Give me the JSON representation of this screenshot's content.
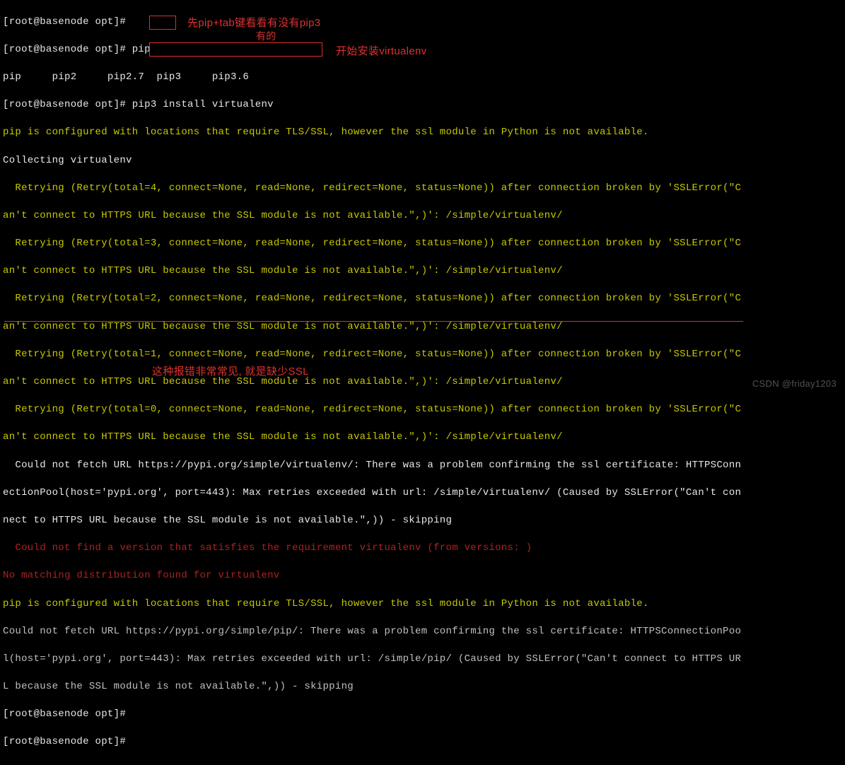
{
  "prompts": {
    "p1": "[root@basenode opt]#",
    "p2": "[root@basenode opt]# ",
    "p3": "[root@basenode opt]# ",
    "p4": "[root@basenode opt]#",
    "p5": "[root@basenode opt]#"
  },
  "cmds": {
    "pip": "pip",
    "install": "pip3 install virtualenv"
  },
  "completions": "pip     pip2     pip2.7  pip3     pip3.6",
  "annos": {
    "a1": "先pip+tab键看看有没有pip3",
    "a2": "有的",
    "a3": "开始安装virtualenv",
    "a4": "这种报错非常常见, 就是缺少SSL"
  },
  "out": {
    "l1": "pip is configured with locations that require TLS/SSL, however the ssl module in Python is not available.",
    "l2": "Collecting virtualenv",
    "r4a": "  Retrying (Retry(total=4, connect=None, read=None, redirect=None, status=None)) after connection broken by 'SSLError(\"C",
    "r4b": "an't connect to HTTPS URL because the SSL module is not available.\",)': /simple/virtualenv/",
    "r3a": "  Retrying (Retry(total=3, connect=None, read=None, redirect=None, status=None)) after connection broken by 'SSLError(\"C",
    "r3b": "an't connect to HTTPS URL because the SSL module is not available.\",)': /simple/virtualenv/",
    "r2a": "  Retrying (Retry(total=2, connect=None, read=None, redirect=None, status=None)) after connection broken by 'SSLError(\"C",
    "r2b": "an't connect to HTTPS URL because the SSL module is not available.\",)': /simple/virtualenv/",
    "r1a": "  Retrying (Retry(total=1, connect=None, read=None, redirect=None, status=None)) after connection broken by 'SSLError(\"C",
    "r1b": "an't connect to HTTPS URL because the SSL module is not available.\",)': /simple/virtualenv/",
    "r0a": "  Retrying (Retry(total=0, connect=None, read=None, redirect=None, status=None)) after connection broken by 'SSLError(\"C",
    "r0b": "an't connect to HTTPS URL because the SSL module is not available.\",)': /simple/virtualenv/",
    "cf1": "  Could not fetch URL https://pypi.org/simple/virtualenv/: There was a problem confirming the ssl certificate: HTTPSConn",
    "cf2": "ectionPool(host='pypi.org', port=443): Max retries exceeded with url: /simple/virtualenv/ (Caused by SSLError(\"Can't con",
    "cf3": "nect to HTTPS URL because the SSL module is not available.\",)) - skipping",
    "nv": "  Could not find a version that satisfies the requirement virtualenv (from versions: )",
    "nm": "No matching distribution found for virtualenv",
    "l3": "pip is configured with locations that require TLS/SSL, however the ssl module in Python is not available.",
    "cf4": "Could not fetch URL https://pypi.org/simple/pip/: There was a problem confirming the ssl certificate: HTTPSConnectionPoo",
    "cf5": "l(host='pypi.org', port=443): Max retries exceeded with url: /simple/pip/ (Caused by SSLError(\"Can't connect to HTTPS UR",
    "cf6": "L because the SSL module is not available.\",)) - skipping"
  },
  "watermark": "CSDN @friday1203"
}
